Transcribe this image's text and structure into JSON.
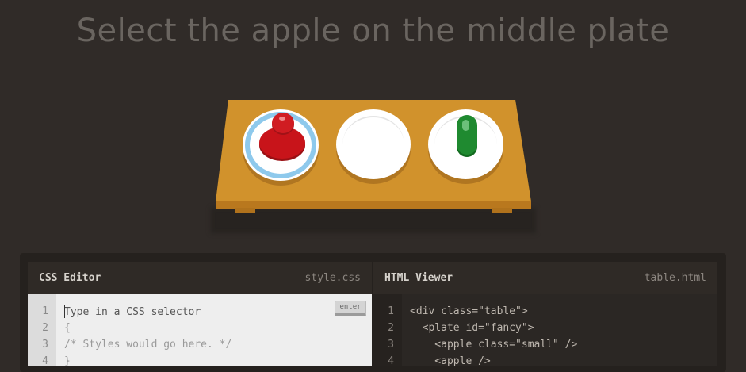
{
  "level": {
    "instruction": "Select the apple on the middle plate"
  },
  "css_editor": {
    "title": "CSS Editor",
    "filename": "style.css",
    "placeholder": "Type in a CSS selector",
    "enter_label": "enter",
    "line_numbers": [
      "1",
      "2",
      "3",
      "4"
    ],
    "lines": [
      "{",
      "/* Styles would go here. */",
      "}"
    ]
  },
  "html_viewer": {
    "title": "HTML Viewer",
    "filename": "table.html",
    "line_numbers": [
      "1",
      "2",
      "3",
      "4"
    ],
    "lines": [
      "<div class=\"table\">",
      "  <plate id=\"fancy\">",
      "    <apple class=\"small\" />",
      "    <apple />"
    ]
  },
  "colors": {
    "background": "#302b28",
    "table": "#d1922c",
    "apple": "#c8141a",
    "pickle": "#1f8a30",
    "fancy_plate_ring": "#8ec9ec"
  }
}
